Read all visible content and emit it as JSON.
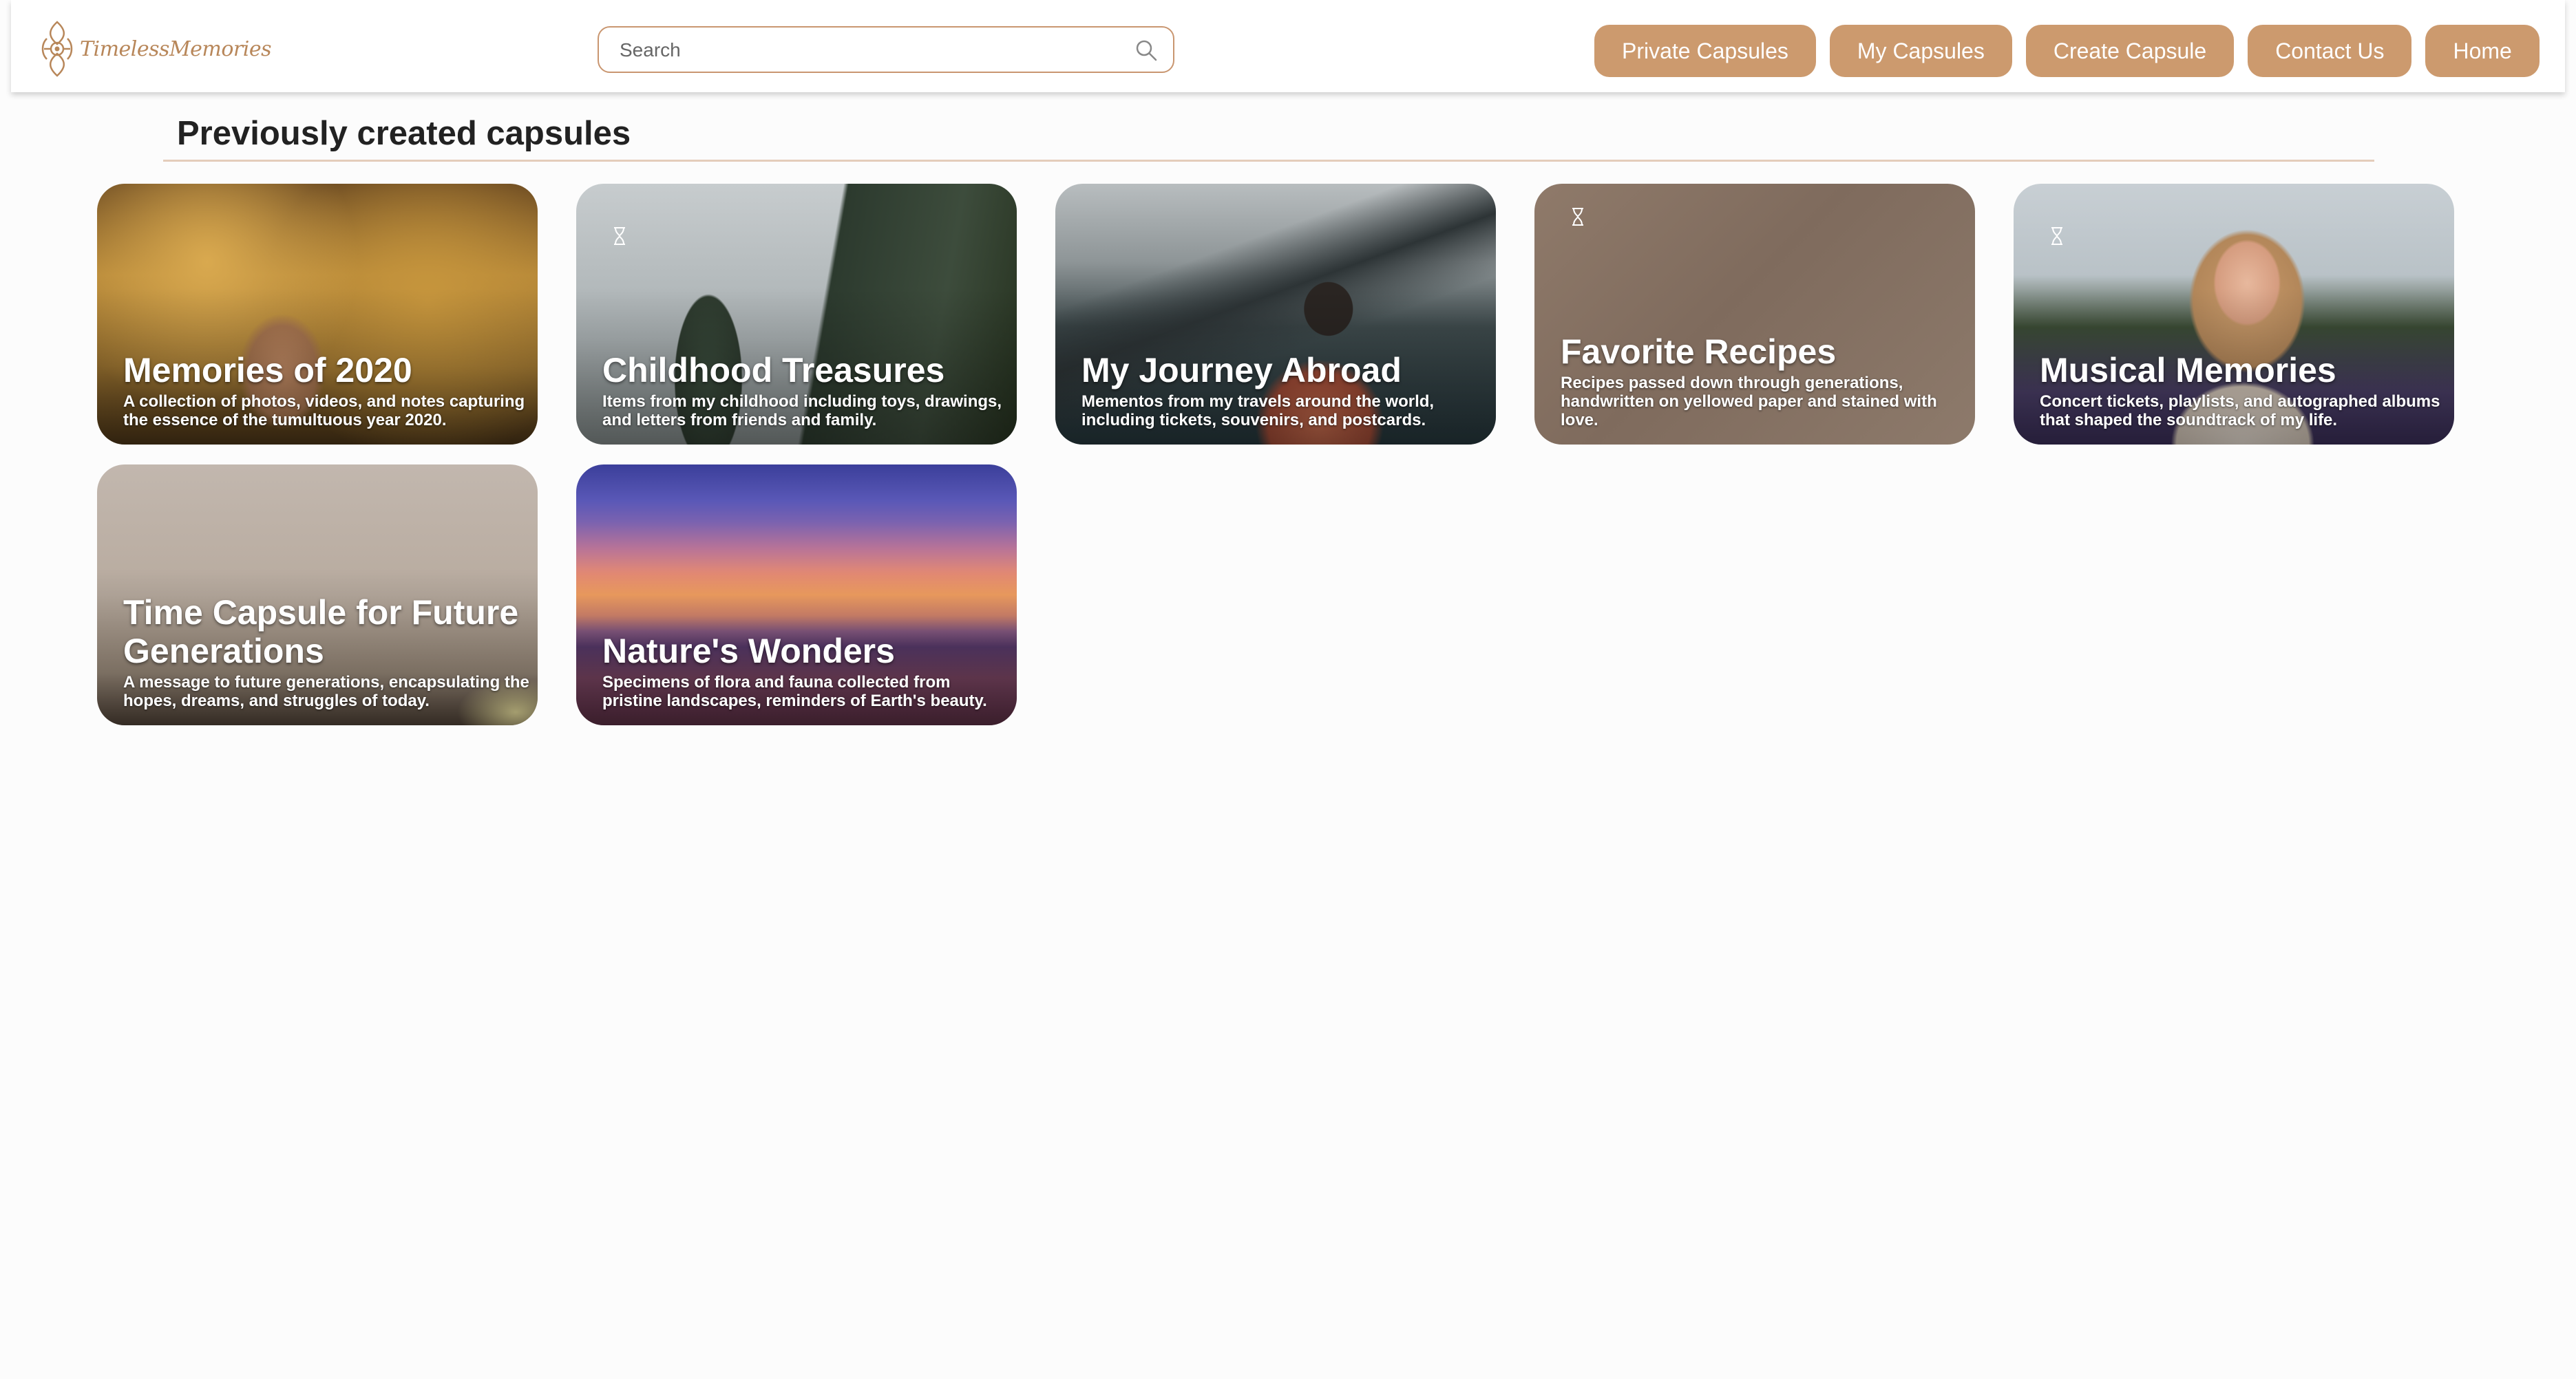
{
  "brand": {
    "name": "TimelessMemories"
  },
  "search": {
    "placeholder": "Search"
  },
  "nav": {
    "private_capsules": "Private Capsules",
    "my_capsules": "My Capsules",
    "create_capsule": "Create Capsule",
    "contact_us": "Contact Us",
    "home": "Home"
  },
  "section": {
    "title": "Previously created capsules"
  },
  "capsules": [
    {
      "title": "Memories of 2020",
      "description": "A collection of photos, videos, and notes capturing the essence of the tumultuous year 2020.",
      "locked": false
    },
    {
      "title": "Childhood Treasures",
      "description": "Items from my childhood including toys, drawings, and letters from friends and family.",
      "locked": true
    },
    {
      "title": "My Journey Abroad",
      "description": "Mementos from my travels around the world, including tickets, souvenirs, and postcards.",
      "locked": false
    },
    {
      "title": "Favorite Recipes",
      "description": "Recipes passed down through generations, handwritten on yellowed paper and stained with love.",
      "locked": true
    },
    {
      "title": "Musical Memories",
      "description": "Concert tickets, playlists, and autographed albums that shaped the soundtrack of my life.",
      "locked": true
    },
    {
      "title": "Time Capsule for Future Generations",
      "description": "A message to future generations, encapsulating the hopes, dreams, and struggles of today.",
      "locked": false
    },
    {
      "title": "Nature's Wonders",
      "description": "Specimens of flora and fauna collected from pristine landscapes, reminders of Earth's beauty.",
      "locked": false
    }
  ],
  "colors": {
    "accent": "#cc9a6e",
    "brand_text": "#b8875a",
    "search_border": "#c99670",
    "section_rule": "#e4cdbb"
  },
  "icons": {
    "search": "search-icon",
    "locked": "hourglass-icon",
    "brand": "logo-icon"
  }
}
